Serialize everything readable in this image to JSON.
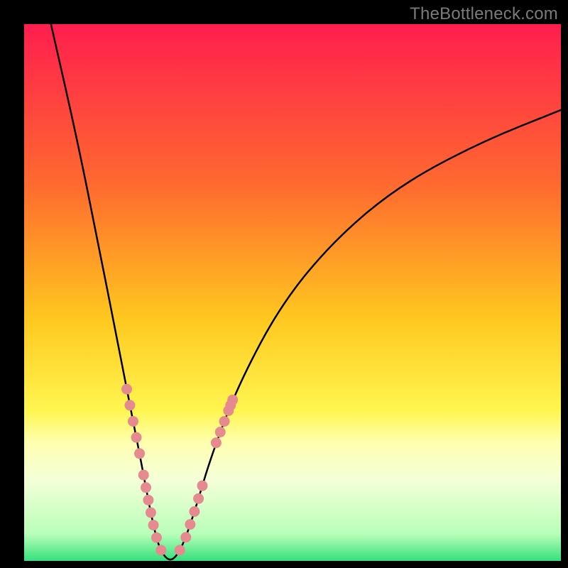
{
  "watermark": "TheBottleneck.com",
  "chart_data": {
    "type": "line",
    "title": "",
    "xlabel": "",
    "ylabel": "",
    "xlim": [
      0,
      100
    ],
    "ylim": [
      0,
      100
    ],
    "gradient_stops": [
      {
        "offset": 0,
        "color": "#ff1e4e"
      },
      {
        "offset": 30,
        "color": "#ff6a2f"
      },
      {
        "offset": 55,
        "color": "#ffc81f"
      },
      {
        "offset": 72,
        "color": "#fff650"
      },
      {
        "offset": 78,
        "color": "#ffffb0"
      },
      {
        "offset": 85,
        "color": "#f4ffd8"
      },
      {
        "offset": 95,
        "color": "#b8ffb8"
      },
      {
        "offset": 100,
        "color": "#34e07d"
      }
    ],
    "curve_left": [
      {
        "x": 5,
        "y": 100
      },
      {
        "x": 10,
        "y": 78
      },
      {
        "x": 14,
        "y": 58
      },
      {
        "x": 17,
        "y": 43
      },
      {
        "x": 19.5,
        "y": 30
      },
      {
        "x": 21.5,
        "y": 20
      },
      {
        "x": 23,
        "y": 12
      },
      {
        "x": 24,
        "y": 7
      },
      {
        "x": 25,
        "y": 3
      },
      {
        "x": 26,
        "y": 1
      },
      {
        "x": 27.2,
        "y": 0
      }
    ],
    "curve_right": [
      {
        "x": 27.2,
        "y": 0
      },
      {
        "x": 28.5,
        "y": 1
      },
      {
        "x": 30,
        "y": 4
      },
      {
        "x": 32,
        "y": 10
      },
      {
        "x": 35,
        "y": 20
      },
      {
        "x": 40,
        "y": 33
      },
      {
        "x": 48,
        "y": 48
      },
      {
        "x": 58,
        "y": 60
      },
      {
        "x": 70,
        "y": 70
      },
      {
        "x": 85,
        "y": 78
      },
      {
        "x": 100,
        "y": 84
      }
    ],
    "marker_clusters": [
      {
        "along": "left",
        "start_y": 32,
        "end_y": 20,
        "count": 5
      },
      {
        "along": "left",
        "start_y": 16,
        "end_y": 2,
        "count": 7
      },
      {
        "along": "right",
        "start_y": 2,
        "end_y": 14,
        "count": 6
      },
      {
        "along": "right",
        "start_y": 22,
        "end_y": 28,
        "count": 4
      },
      {
        "along": "right",
        "start_y": 29,
        "end_y": 30,
        "count": 2
      }
    ],
    "marker_color": "#e58b8f",
    "curve_color": "#000000",
    "curve_width": 2.5
  }
}
